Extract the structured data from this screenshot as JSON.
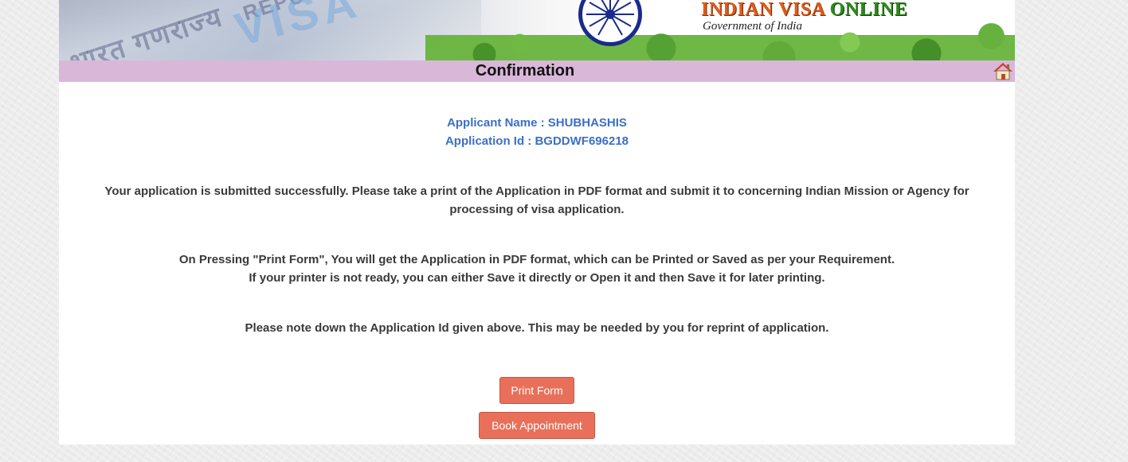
{
  "header": {
    "banner_words": {
      "hindi_text": "भारत गणराज्य",
      "repo_text": "REPU",
      "visa_text": "VISA"
    },
    "brand_title_a": "INDIAN VISA",
    "brand_title_b": "ONLINE",
    "brand_subtitle": "Government of India",
    "icons": {
      "emblem": "ashoka-chakra-icon",
      "home": "home-icon"
    }
  },
  "titlebar": {
    "title": "Confirmation"
  },
  "applicant": {
    "name_line": "Applicant Name : SHUBHASHIS",
    "id_line": "Application Id : BGDDWF696218"
  },
  "messages": {
    "submitted_line1": "Your application is submitted successfully. Please take a print of the Application in PDF format and submit it to concerning Indian Mission or Agency for",
    "submitted_line2": "processing of visa application.",
    "print_line1": "On Pressing \"Print Form\", You will get the Application in PDF format, which can be Printed or Saved as per your Requirement.",
    "print_line2": "If your printer is not ready, you can either Save it directly or Open it and then Save it for later printing.",
    "note_line": "Please note down the Application Id given above. This may be needed by you for reprint of application."
  },
  "buttons": {
    "print_form": "Print Form",
    "book_appointment": "Book Appointment"
  },
  "colors": {
    "title_bar": "#d9b7d9",
    "applicant_text": "#3b6fc7",
    "button_bg": "#e8705a",
    "body_text": "#3a3a3a"
  }
}
